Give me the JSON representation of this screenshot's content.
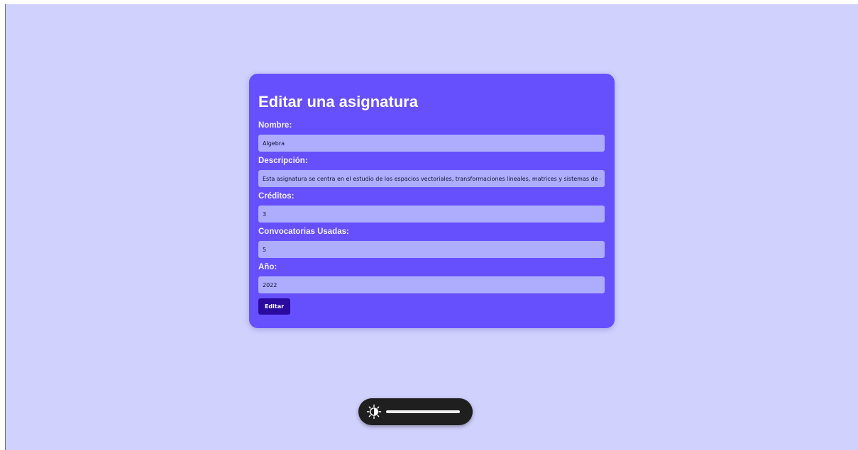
{
  "form": {
    "title": "Editar una asignatura",
    "fields": [
      {
        "label": "Nombre:",
        "value": "Algebra"
      },
      {
        "label": "Descripción:",
        "value": "Esta asignatura se centra en el estudio de los espacios vectoriales, transformaciones lineales, matrices y sistemas de ecua"
      },
      {
        "label": "Créditos:",
        "value": "3"
      },
      {
        "label": "Convocatorias Usadas:",
        "value": "5"
      },
      {
        "label": "Año:",
        "value": "2022"
      }
    ],
    "submit_label": "Editar"
  },
  "brightness_osd": {
    "icon": "brightness-icon",
    "level": 1.0
  },
  "colors": {
    "page_background": "#d1d1fe",
    "card_background": "#6650fe",
    "field_background": "#adacfd",
    "button_background": "#2b0aa0"
  }
}
